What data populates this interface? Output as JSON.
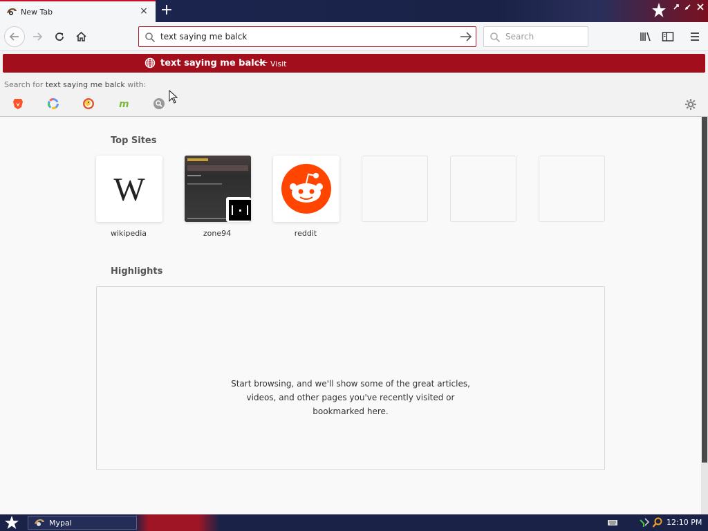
{
  "tab": {
    "title": "New Tab",
    "close_glyph": "×",
    "new_tab_glyph": "+"
  },
  "toolbar": {
    "url_value": "text saying me balck",
    "search_placeholder": "Search"
  },
  "dropdown": {
    "suggestion_text": "text saying me balck",
    "suggestion_dash": "—",
    "suggestion_action": "Visit",
    "search_for_prefix": "Search for",
    "search_for_query": "text saying me balck",
    "search_for_suffix": "with:",
    "engines": [
      "brave-icon",
      "qwant-icon",
      "duckduckgo-icon",
      "mojeek-icon",
      "search-engine-icon"
    ]
  },
  "main": {
    "top_sites_title": "Top Sites",
    "top_sites": [
      {
        "label": "wikipedia",
        "tile_glyph": "W"
      },
      {
        "label": "zone94"
      },
      {
        "label": "reddit"
      },
      {
        "label": ""
      },
      {
        "label": ""
      },
      {
        "label": ""
      }
    ],
    "highlights_title": "Highlights",
    "highlights_empty": [
      "Start browsing, and we'll show some of the great articles,",
      "videos, and other pages you've recently visited or",
      "bookmarked here."
    ]
  },
  "taskbar": {
    "task_label": "Mypal",
    "clock": "12:10 PM"
  },
  "colors": {
    "accent": "#a30e1c",
    "url_border": "#b5162b",
    "taskbar": "#1a2248",
    "reddit": "#ff4500"
  }
}
